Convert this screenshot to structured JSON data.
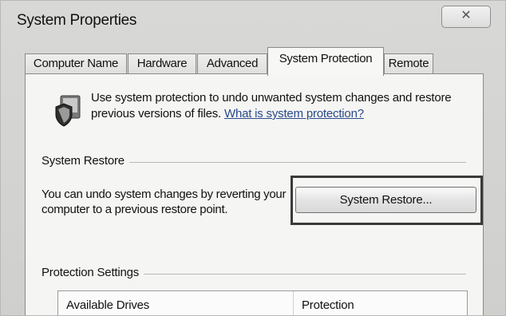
{
  "window": {
    "title": "System Properties",
    "close_label": "✕"
  },
  "tabs": [
    {
      "label": "Computer Name",
      "active": false
    },
    {
      "label": "Hardware",
      "active": false
    },
    {
      "label": "Advanced",
      "active": false
    },
    {
      "label": "System Protection",
      "active": true
    },
    {
      "label": "Remote",
      "active": false
    }
  ],
  "info": {
    "text": "Use system protection to undo unwanted system changes and restore previous versions of files.",
    "link": "What is system protection?",
    "icon": "system-protection-shield-icon"
  },
  "system_restore": {
    "group_label": "System Restore",
    "description": "You can undo system changes by reverting your computer to a previous restore point.",
    "button_label": "System Restore..."
  },
  "protection_settings": {
    "group_label": "Protection Settings",
    "columns": [
      "Available Drives",
      "Protection"
    ]
  },
  "colors": {
    "link": "#2a4a8a",
    "highlight_border": "#3a3a3a"
  }
}
